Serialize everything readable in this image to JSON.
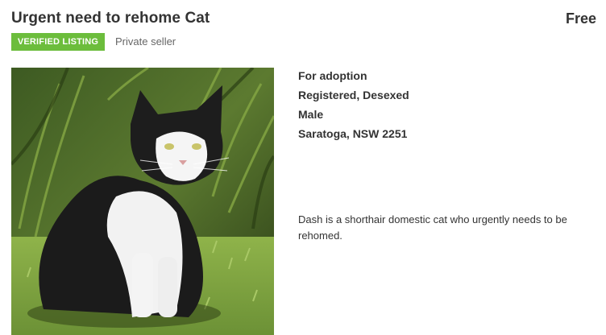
{
  "listing": {
    "title": "Urgent need to rehome Cat",
    "price": "Free",
    "badge": "VERIFIED LISTING",
    "seller_type": "Private seller",
    "photo_alt": "Black and white cat sitting on grass",
    "details": [
      "For adoption",
      "Registered, Desexed",
      "Male",
      "Saratoga, NSW 2251"
    ],
    "description": "Dash is a shorthair domestic cat who urgently needs to be rehomed."
  },
  "colors": {
    "badge_bg": "#6cbd3c",
    "text": "#333333",
    "muted": "#666666"
  }
}
